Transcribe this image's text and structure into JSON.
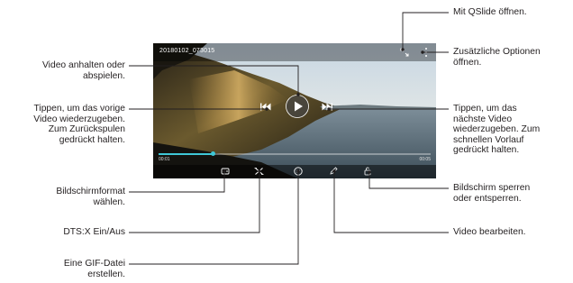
{
  "player": {
    "file_name": "20180102_073015",
    "time_elapsed": "00:01",
    "time_total": "00:05",
    "progress": 0.2
  },
  "icons": {
    "qslide": "qslide-icon",
    "more_options": "more-options-icon",
    "play": "play-icon",
    "previous": "skip-previous-icon",
    "next": "skip-next-icon",
    "screen_ratio": "screen-ratio-icon",
    "dtsx": "dtsx-icon",
    "gif": "gif-icon",
    "edit": "pencil-icon",
    "lock": "lock-icon"
  },
  "colors": {
    "line": "#231f20",
    "text": "#231f20",
    "accent": "#3fc7d6"
  },
  "callouts": {
    "qslide": "Mit QSlide öffnen.",
    "more_options": "Zusätzliche Optionen\nöffnen.",
    "pause_play": "Video anhalten oder\nabspielen.",
    "previous": "Tippen, um das vorige\nVideo wiederzugeben.\nZum Zurückspulen\ngedrückt halten.",
    "next": "Tippen, um das\nnächste Video\nwiederzugeben. Zum\nschnellen Vorlauf\ngedrückt halten.",
    "screen_ratio": "Bildschirmformat\nwählen.",
    "dtsx": "DTS:X Ein/Aus",
    "gif": "Eine GIF-Datei\nerstellen.",
    "lock": "Bildschirm sperren\noder entsperren.",
    "edit": "Video bearbeiten."
  }
}
